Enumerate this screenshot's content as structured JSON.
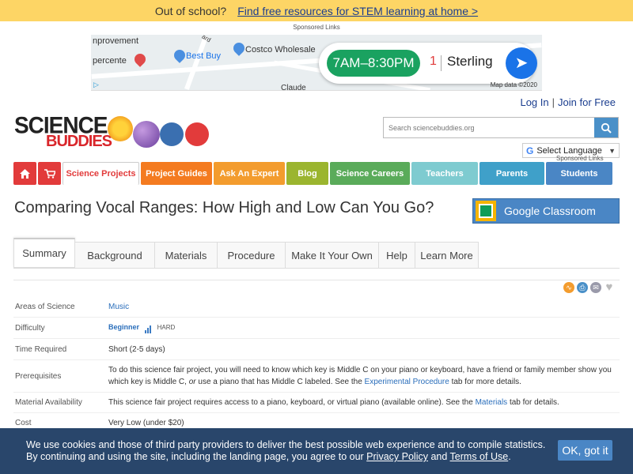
{
  "promo": {
    "lead": "Out of school?",
    "link": "Find free resources for STEM learning at home  >"
  },
  "ad": {
    "sponsored": "Sponsored Links",
    "map_labels": [
      "nprovement",
      "percente",
      "Best Buy",
      "Costco Wholesale",
      "Claude",
      "ard"
    ],
    "hours": "7AM–8:30PM",
    "index": "1",
    "place": "Sterling",
    "attribution": "Map data ©2020",
    "adchoices": "▷"
  },
  "header": {
    "login": "Log In",
    "divider": "|",
    "join": "Join for Free",
    "logo_line1": "SCIENCE",
    "logo_line2": "BUDDIES",
    "search_placeholder": "Search sciencebuddies.org",
    "translate_g": "G",
    "translate_label": "Select Language",
    "translate_arrow": "▼",
    "sponsored": "Sponsored Links"
  },
  "nav": {
    "items": [
      {
        "label": "Science Projects",
        "color": "#ffffff"
      },
      {
        "label": "Project Guides",
        "color": "#f47b20"
      },
      {
        "label": "Ask An Expert",
        "color": "#f39c2e"
      },
      {
        "label": "Blog",
        "color": "#9bb52f"
      },
      {
        "label": "Science Careers",
        "color": "#5aab5a"
      },
      {
        "label": "Teachers",
        "color": "#7ecbd0"
      },
      {
        "label": "Parents",
        "color": "#3fa0c9"
      },
      {
        "label": "Students",
        "color": "#4a86c5"
      }
    ]
  },
  "page": {
    "title": "Comparing Vocal Ranges: How High and Low Can You Go?",
    "classroom": "Google Classroom"
  },
  "tabs": [
    "Summary",
    "Background",
    "Materials",
    "Procedure",
    "Make It Your Own",
    "Help",
    "Learn More"
  ],
  "info": {
    "areas_label": "Areas of Science",
    "areas_value": "Music",
    "difficulty_label": "Difficulty",
    "difficulty_value": "Beginner",
    "difficulty_hard": "HARD",
    "time_label": "Time Required",
    "time_value": "Short (2-5 days)",
    "prereq_label": "Prerequisites",
    "prereq_a": "To do this science fair project, you will need to know which key is Middle C on your piano or keyboard, have a friend or family member show you which key is Middle C, ",
    "prereq_or": "or",
    "prereq_b": " use a piano that has Middle C labeled. See the ",
    "prereq_link": "Experimental Procedure",
    "prereq_c": " tab for more details.",
    "material_label": "Material Availability",
    "material_a": "This science fair project requires access to a piano, keyboard, or virtual piano (available online). See the ",
    "material_link": "Materials",
    "material_b": " tab for details.",
    "cost_label": "Cost",
    "cost_value": "Very Low (under $20)"
  },
  "cookie": {
    "line1": "We use cookies and those of third party providers to deliver the best possible web experience and to compile statistics.",
    "line2a": "By continuing and using the site, including the landing page, you agree to our ",
    "privacy": "Privacy Policy",
    "and": " and ",
    "terms": "Terms of Use",
    "end": ".",
    "ok": "OK, got it"
  }
}
